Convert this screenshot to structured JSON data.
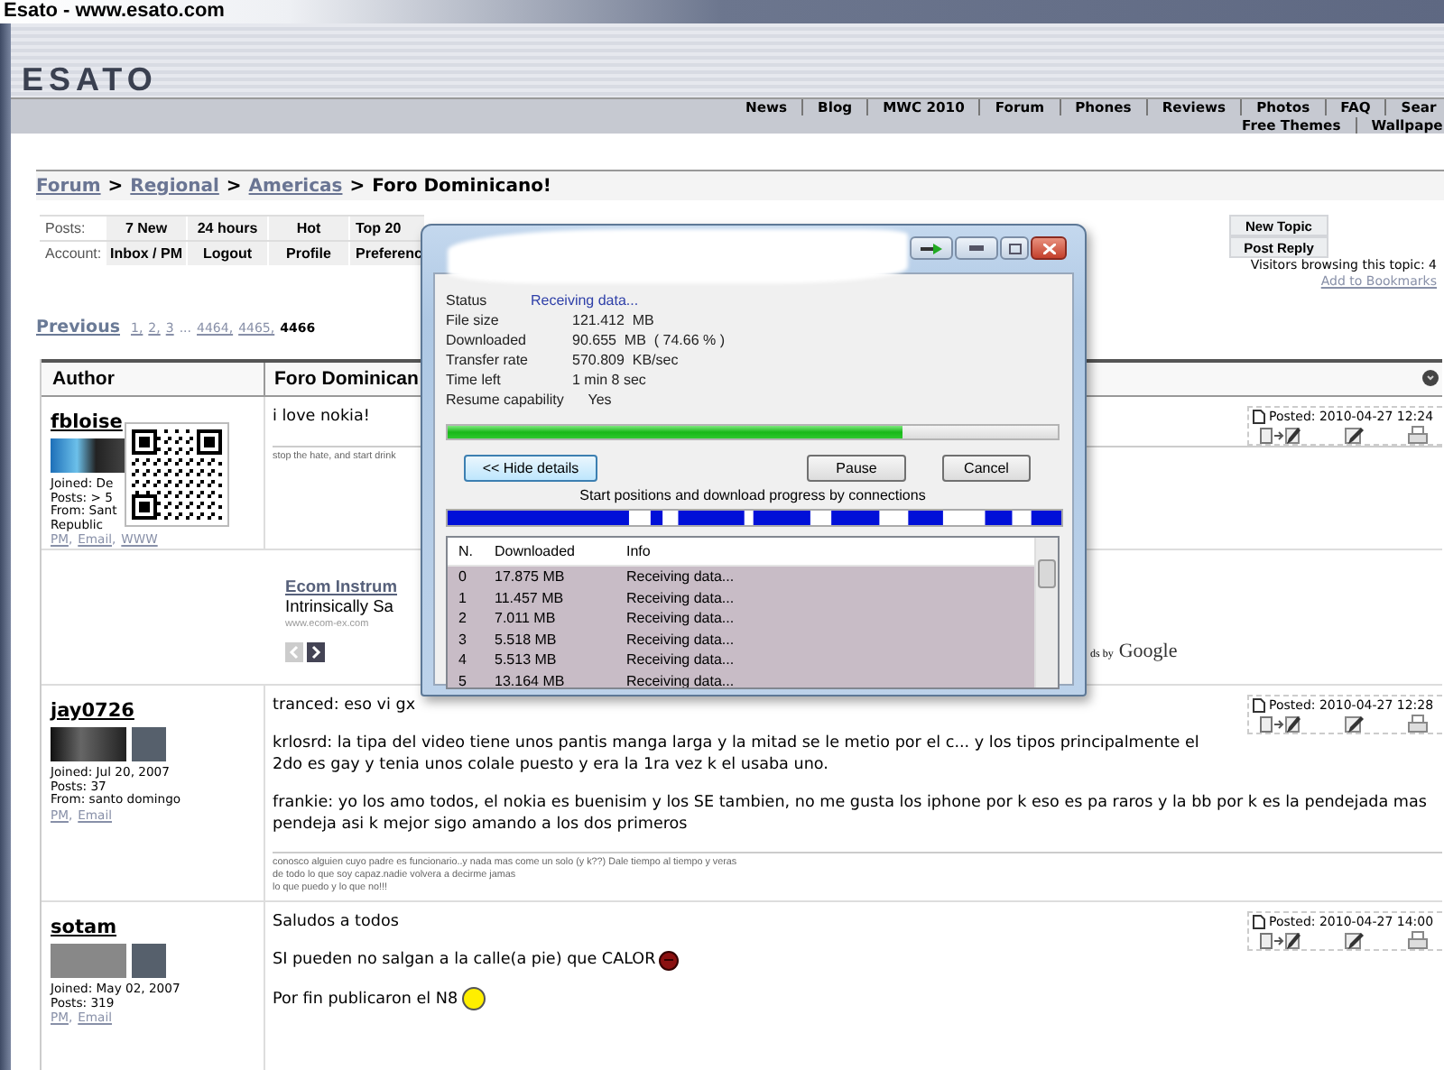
{
  "window": {
    "title": "Esato - www.esato.com"
  },
  "header": {
    "logo": "ESATO",
    "nav": [
      "News",
      "Blog",
      "MWC 2010",
      "Forum",
      "Phones",
      "Reviews",
      "Photos",
      "FAQ",
      "Sear"
    ],
    "nav_second_row": [
      "Free Themes",
      "Wallpape"
    ]
  },
  "breadcrumb": [
    {
      "text": "Forum",
      "kind": "link"
    },
    {
      "text": ">",
      "kind": "sep"
    },
    {
      "text": "Regional",
      "kind": "link"
    },
    {
      "text": ">",
      "kind": "sep"
    },
    {
      "text": "Americas",
      "kind": "link"
    },
    {
      "text": ">",
      "kind": "sep"
    },
    {
      "text": "Foro Dominicano!",
      "kind": "current"
    }
  ],
  "toolbar": [
    {
      "label": "Posts:",
      "buttons": [
        "7 New",
        "24 hours",
        "Hot",
        "Top 20"
      ]
    },
    {
      "label": "Account:",
      "buttons": [
        "Inbox / PM",
        "Logout",
        "Profile",
        "Preferenc"
      ]
    }
  ],
  "topic": {
    "buttons": [
      "New Topic",
      "Post Reply"
    ],
    "visitors": "Visitors browsing this topic: 4",
    "bookmark_link": "Add to Bookmarks"
  },
  "pagination": {
    "previous": "Previous",
    "pages": [
      {
        "label": "1,",
        "kind": "link"
      },
      {
        "label": "2,",
        "kind": "link"
      },
      {
        "label": "3",
        "kind": "link"
      },
      {
        "label": "...",
        "kind": "gap"
      },
      {
        "label": "4464,",
        "kind": "link"
      },
      {
        "label": "4465,",
        "kind": "link"
      },
      {
        "label": "4466",
        "kind": "current"
      }
    ]
  },
  "table": {
    "columns": [
      "Author",
      "Foro Dominican"
    ],
    "rows": [
      {
        "kind": "post",
        "author": "fbloise",
        "qr_code": true,
        "details": [
          "Joined: De",
          "Posts: > 5",
          "From: Sant",
          "Republic"
        ],
        "links": [
          {
            "text": "PM",
            "suffix": ","
          },
          {
            "text": "Email",
            "suffix": ","
          },
          {
            "text": "WWW"
          }
        ],
        "posted": "Posted: 2010-04-27 12:24",
        "message": [
          {
            "text": "i love nokia!"
          }
        ],
        "signature": [
          "stop the hate, and start drink"
        ]
      },
      {
        "kind": "ad",
        "title": "Ecom Instrum",
        "text": "Intrinsically Sa",
        "url": "www.ecom-ex.com",
        "attribution": "ds by",
        "brand": "Google"
      },
      {
        "kind": "post",
        "author": "jay0726",
        "qr_code": false,
        "details": [
          "Joined: Jul 20, 2007",
          "Posts: 37",
          "From: santo domingo"
        ],
        "links": [
          {
            "text": "PM",
            "suffix": ","
          },
          {
            "text": "Email"
          }
        ],
        "posted": "Posted: 2010-04-27 12:28",
        "message": [
          {
            "text": "tranced: eso vi gx"
          },
          {
            "text": "krlosrd: la tipa del video tiene unos pantis manga larga y la mitad se le metio por el c... y los tipos principalmente el 2do es gay y tenia unos colale puesto y era la 1ra vez k el usaba uno."
          },
          {
            "text": "frankie: yo los amo todos, el nokia es buenisim y los SE tambien, no me gusta los iphone por k eso es pa raros y la bb por k es la pendejada mas pendeja asi k mejor sigo amando a los dos primeros"
          }
        ],
        "signature": [
          "conosco alguien cuyo padre es funcionario..y nada mas come un solo (y k??) Dale tiempo al tiempo y veras",
          "de todo lo que soy capaz.nadie volvera a decirme jamas",
          "lo que puedo y lo que no!!!"
        ]
      },
      {
        "kind": "post",
        "author": "sotam",
        "qr_code": false,
        "details": [
          "Joined: May 02, 2007",
          "Posts: 319"
        ],
        "links": [
          {
            "text": "PM",
            "suffix": ","
          },
          {
            "text": "Email"
          }
        ],
        "posted": "Posted: 2010-04-27 14:00",
        "message": [
          {
            "text": "Saludos a todos"
          },
          {
            "text": "SI pueden no salgan a la calle(a pie) que CALOR",
            "kind": "ball"
          },
          {
            "text": "Por fin publicaron el N8",
            "kind": "smiley"
          }
        ],
        "signature": []
      }
    ]
  },
  "download_dialog": {
    "status_label": "Status",
    "status": "Receiving data...",
    "fields": [
      {
        "label": "File size",
        "value": "121.412  MB"
      },
      {
        "label": "Downloaded",
        "value": "90.655  MB  ( 74.66 % )"
      },
      {
        "label": "Transfer rate",
        "value": "570.809  KB/sec"
      },
      {
        "label": "Time left",
        "value": "1 min 8 sec"
      },
      {
        "label": "Resume capability",
        "value": "    Yes"
      }
    ],
    "level": 0.7466,
    "buttons": [
      "<< Hide details",
      "Pause",
      "Cancel"
    ],
    "connections_caption": "Start positions and download progress by connections",
    "columns": [
      "N.",
      "Downloaded",
      "Info"
    ],
    "connections": [
      {
        "n": "0",
        "downloaded": "17.875 MB",
        "info": "Receiving data..."
      },
      {
        "n": "1",
        "downloaded": "11.457 MB",
        "info": "Receiving data..."
      },
      {
        "n": "2",
        "downloaded": "7.011 MB",
        "info": "Receiving data..."
      },
      {
        "n": "3",
        "downloaded": "5.518 MB",
        "info": "Receiving data..."
      },
      {
        "n": "4",
        "downloaded": "5.513 MB",
        "info": "Receiving data..."
      },
      {
        "n": "5",
        "downloaded": "13.164 MB",
        "info": "Receiving data..."
      }
    ]
  }
}
